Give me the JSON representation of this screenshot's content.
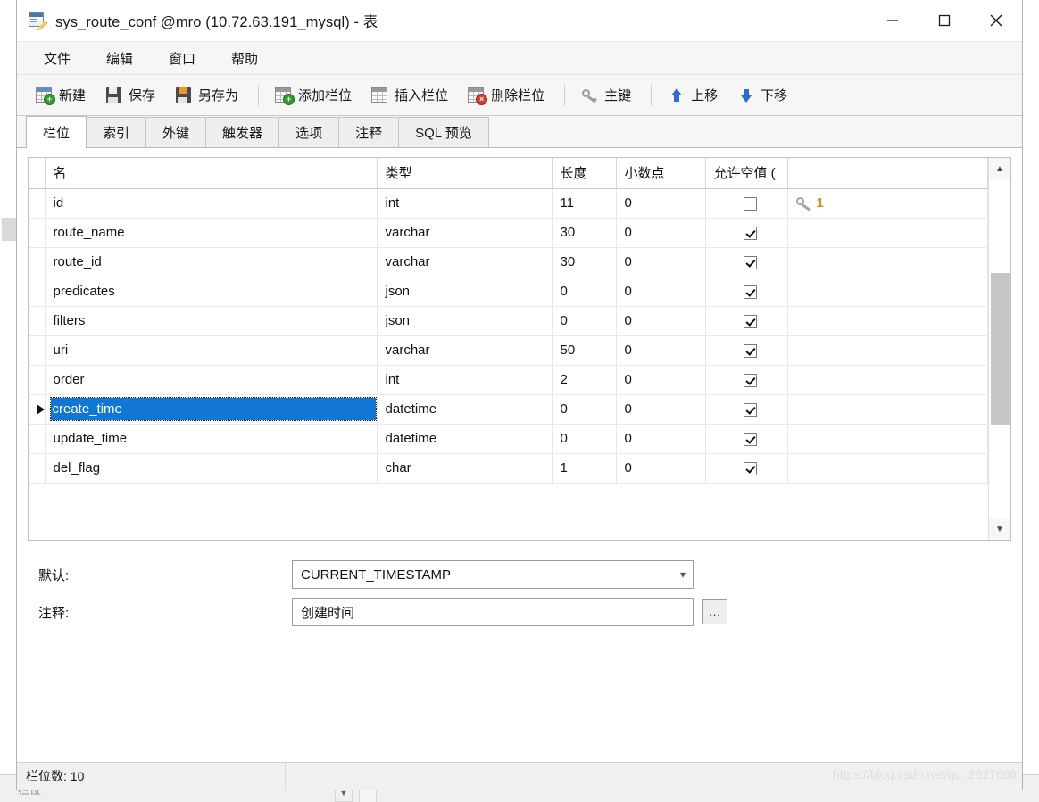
{
  "window": {
    "title": "sys_route_conf @mro (10.72.63.191_mysql) - 表",
    "icon": "table-edit-icon",
    "controls": {
      "minimize": "minimize-icon",
      "maximize": "maximize-icon",
      "close": "close-icon"
    }
  },
  "menubar": {
    "items": [
      {
        "label": "文件"
      },
      {
        "label": "编辑"
      },
      {
        "label": "窗口"
      },
      {
        "label": "帮助"
      }
    ]
  },
  "toolbar": {
    "groups": [
      {
        "buttons": [
          {
            "label": "新建",
            "icon": "new-table-icon"
          },
          {
            "label": "保存",
            "icon": "save-icon"
          },
          {
            "label": "另存为",
            "icon": "save-as-icon"
          }
        ]
      },
      {
        "buttons": [
          {
            "label": "添加栏位",
            "icon": "add-field-icon"
          },
          {
            "label": "插入栏位",
            "icon": "insert-field-icon"
          },
          {
            "label": "删除栏位",
            "icon": "delete-field-icon"
          }
        ]
      },
      {
        "buttons": [
          {
            "label": "主键",
            "icon": "primary-key-icon"
          }
        ]
      },
      {
        "buttons": [
          {
            "label": "上移",
            "icon": "arrow-up-icon"
          },
          {
            "label": "下移",
            "icon": "arrow-down-icon"
          }
        ]
      }
    ]
  },
  "tabs": {
    "active_index": 0,
    "items": [
      {
        "label": "栏位"
      },
      {
        "label": "索引"
      },
      {
        "label": "外键"
      },
      {
        "label": "触发器"
      },
      {
        "label": "选项"
      },
      {
        "label": "注释"
      },
      {
        "label": "SQL 预览"
      }
    ]
  },
  "grid": {
    "columns": [
      {
        "label": "名"
      },
      {
        "label": "类型"
      },
      {
        "label": "长度"
      },
      {
        "label": "小数点"
      },
      {
        "label": "允许空值 ("
      },
      {
        "label": ""
      }
    ],
    "selected_row_index": 7,
    "rows": [
      {
        "name": "id",
        "type": "int",
        "length": "11",
        "decimals": "0",
        "nullable": false,
        "key": "1",
        "selected": false
      },
      {
        "name": "route_name",
        "type": "varchar",
        "length": "30",
        "decimals": "0",
        "nullable": true,
        "key": "",
        "selected": false
      },
      {
        "name": "route_id",
        "type": "varchar",
        "length": "30",
        "decimals": "0",
        "nullable": true,
        "key": "",
        "selected": false
      },
      {
        "name": "predicates",
        "type": "json",
        "length": "0",
        "decimals": "0",
        "nullable": true,
        "key": "",
        "selected": false
      },
      {
        "name": "filters",
        "type": "json",
        "length": "0",
        "decimals": "0",
        "nullable": true,
        "key": "",
        "selected": false
      },
      {
        "name": "uri",
        "type": "varchar",
        "length": "50",
        "decimals": "0",
        "nullable": true,
        "key": "",
        "selected": false
      },
      {
        "name": "order",
        "type": "int",
        "length": "2",
        "decimals": "0",
        "nullable": true,
        "key": "",
        "selected": false
      },
      {
        "name": "create_time",
        "type": "datetime",
        "length": "0",
        "decimals": "0",
        "nullable": true,
        "key": "",
        "selected": true
      },
      {
        "name": "update_time",
        "type": "datetime",
        "length": "0",
        "decimals": "0",
        "nullable": true,
        "key": "",
        "selected": false
      },
      {
        "name": "del_flag",
        "type": "char",
        "length": "1",
        "decimals": "0",
        "nullable": true,
        "key": "",
        "selected": false
      }
    ],
    "scrollbar": {
      "up_arrow": "chevron-up-icon",
      "down_arrow": "chevron-down-icon"
    }
  },
  "form": {
    "default_label": "默认:",
    "default_value": "CURRENT_TIMESTAMP",
    "comment_label": "注释:",
    "comment_value": "创建时间",
    "ellipsis_button": "..."
  },
  "statusbar": {
    "field_count": "栏位数: 10",
    "watermark": "https://blog.csdn.net/qq_2627666"
  },
  "colors": {
    "selection": "#1276d4",
    "accent_blue": "#2f6fc0",
    "key_orange": "#e08a1e",
    "toolbar_bg": "#f6f6f6"
  }
}
